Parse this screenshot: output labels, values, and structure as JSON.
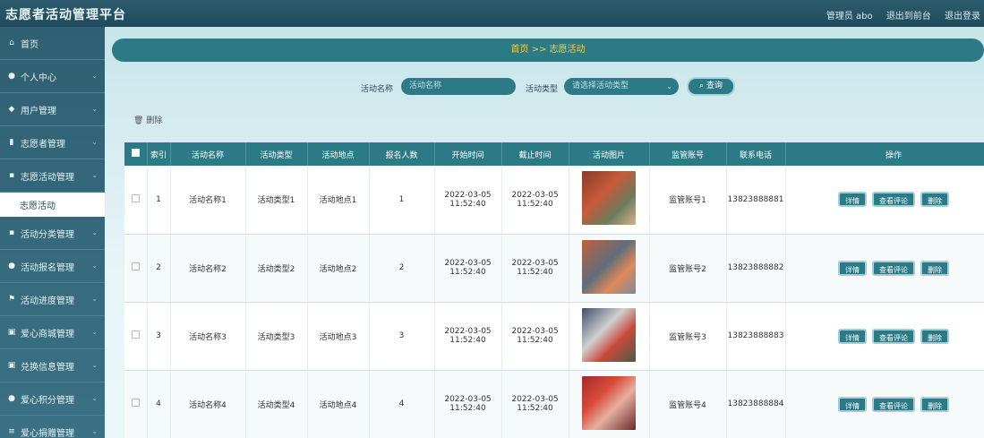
{
  "header": {
    "title": "志愿者活动管理平台",
    "links": [
      "管理员 abo",
      "退出到前台",
      "退出登录"
    ]
  },
  "sidebar": {
    "items": [
      {
        "icon": "home-icon",
        "glyph": "⌂",
        "label": "首页",
        "chevron": false
      },
      {
        "icon": "user-icon",
        "glyph": "●",
        "label": "个人中心",
        "chevron": true
      },
      {
        "icon": "pin-icon",
        "glyph": "◆",
        "label": "用户管理",
        "chevron": true
      },
      {
        "icon": "chart-icon",
        "glyph": "▮",
        "label": "志愿者管理",
        "chevron": true
      },
      {
        "icon": "grid-icon",
        "glyph": "▪",
        "label": "志愿活动管理",
        "chevron": true
      }
    ],
    "sub_item_text": "志愿活动",
    "items_after": [
      {
        "icon": "grid-icon",
        "glyph": "▪",
        "label": "活动分类管理",
        "chevron": true
      },
      {
        "icon": "user-icon",
        "glyph": "●",
        "label": "活动报名管理",
        "chevron": true
      },
      {
        "icon": "flag-icon",
        "glyph": "⚑",
        "label": "活动进度管理",
        "chevron": true
      },
      {
        "icon": "doc-icon",
        "glyph": "▣",
        "label": "爱心商城管理",
        "chevron": true
      },
      {
        "icon": "doc-icon",
        "glyph": "▣",
        "label": "兑换信息管理",
        "chevron": true
      },
      {
        "icon": "user-icon",
        "glyph": "●",
        "label": "爱心积分管理",
        "chevron": true
      },
      {
        "icon": "menu-icon",
        "glyph": "≡",
        "label": "爱心捐赠管理",
        "chevron": true
      }
    ]
  },
  "breadcrumb": "首页 >> 志愿活动",
  "search": {
    "name_label": "活动名称",
    "name_placeholder": "活动名称",
    "type_label": "活动类型",
    "type_placeholder": "请选择活动类型",
    "button": "查询"
  },
  "toolbar": {
    "delete_label": "删除"
  },
  "table": {
    "columns": [
      "索引",
      "活动名称",
      "活动类型",
      "活动地点",
      "报名人数",
      "开始时间",
      "截止时间",
      "活动图片",
      "监管账号",
      "联系电话",
      "操作"
    ],
    "rows": [
      {
        "index": "1",
        "name": "活动名称1",
        "type": "活动类型1",
        "place": "活动地点1",
        "count": "1",
        "start": "2022-03-05 11:52:40",
        "end": "2022-03-05 11:52:40",
        "account": "监管账号1",
        "phone": "13823888881"
      },
      {
        "index": "2",
        "name": "活动名称2",
        "type": "活动类型2",
        "place": "活动地点2",
        "count": "2",
        "start": "2022-03-05 11:52:40",
        "end": "2022-03-05 11:52:40",
        "account": "监管账号2",
        "phone": "13823888882"
      },
      {
        "index": "3",
        "name": "活动名称3",
        "type": "活动类型3",
        "place": "活动地点3",
        "count": "3",
        "start": "2022-03-05 11:52:40",
        "end": "2022-03-05 11:52:40",
        "account": "监管账号3",
        "phone": "13823888883"
      },
      {
        "index": "4",
        "name": "活动名称4",
        "type": "活动类型4",
        "place": "活动地点4",
        "count": "4",
        "start": "2022-03-05 11:52:40",
        "end": "2022-03-05 11:52:40",
        "account": "监管账号4",
        "phone": "13823888884"
      }
    ],
    "actions": [
      "详情",
      "查看评论",
      "删除"
    ]
  }
}
